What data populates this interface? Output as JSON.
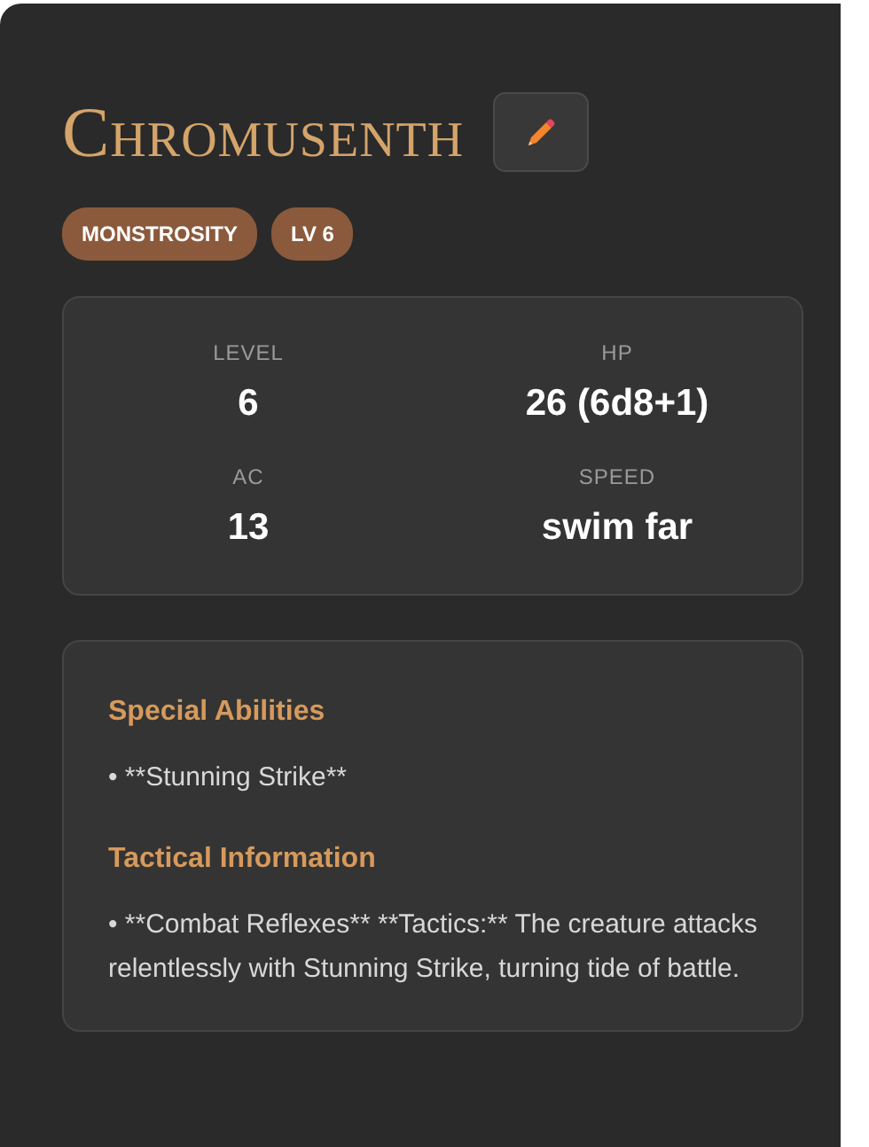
{
  "title": "Chromusenth",
  "badges": [
    "MONSTROSITY",
    "LV 6"
  ],
  "stats": [
    {
      "label": "LEVEL",
      "value": "6"
    },
    {
      "label": "HP",
      "value": "26 (6d8+1)"
    },
    {
      "label": "AC",
      "value": "13"
    },
    {
      "label": "SPEED",
      "value": "swim far"
    }
  ],
  "sections": [
    {
      "heading": "Special Abilities",
      "text": "• **Stunning Strike**"
    },
    {
      "heading": "Tactical Information",
      "text": "• **Combat Reflexes** **Tactics:** The creature attacks relentlessly with Stunning Strike, turning tide of battle."
    }
  ]
}
